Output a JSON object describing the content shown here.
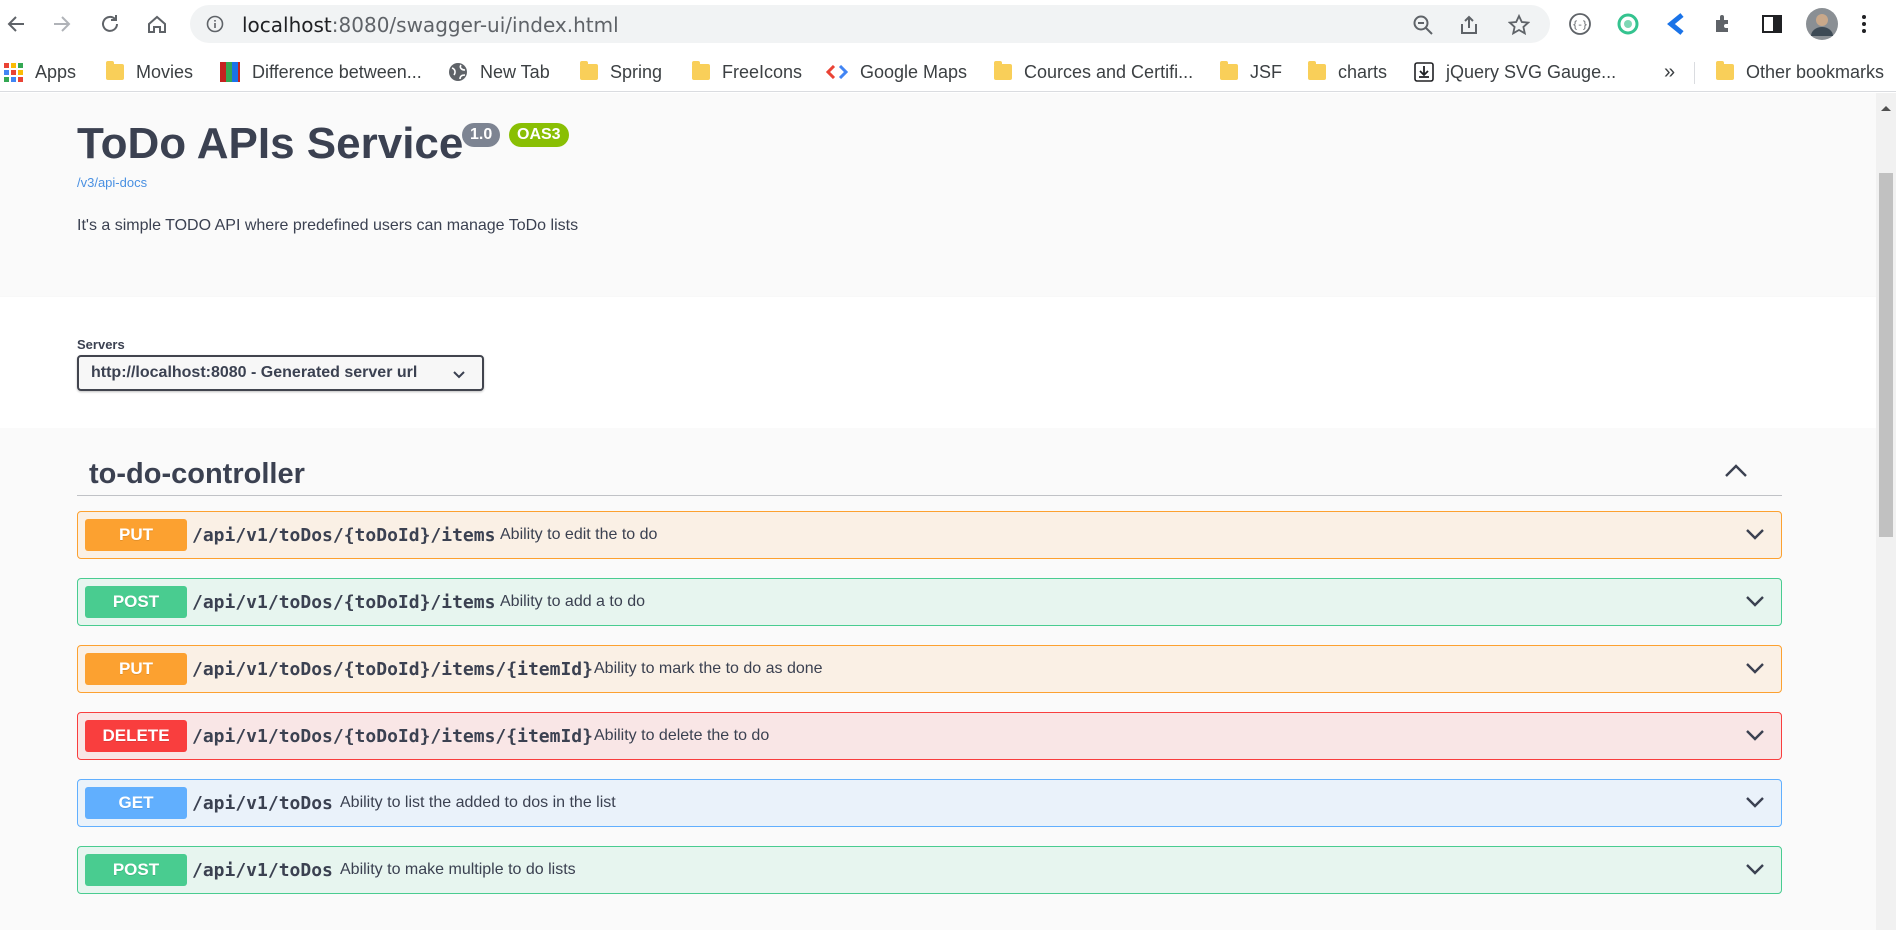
{
  "browser": {
    "url_host": "localhost",
    "url_rest": ":8080/swagger-ui/index.html",
    "bookmarks": [
      {
        "label": "Apps",
        "icon": "apps-grid-icon"
      },
      {
        "label": "Movies",
        "icon": "folder-icon"
      },
      {
        "label": "Difference between...",
        "icon": "site-icon"
      },
      {
        "label": "New Tab",
        "icon": "globe-icon"
      },
      {
        "label": "Spring",
        "icon": "folder-icon"
      },
      {
        "label": "FreeIcons",
        "icon": "folder-icon"
      },
      {
        "label": "Google Maps",
        "icon": "maps-icon"
      },
      {
        "label": "Cources and Certifi...",
        "icon": "folder-icon"
      },
      {
        "label": "JSF",
        "icon": "folder-icon"
      },
      {
        "label": "charts",
        "icon": "folder-icon"
      },
      {
        "label": "jQuery SVG Gauge...",
        "icon": "download-icon"
      }
    ],
    "overflow": "»",
    "other_bookmarks": "Other bookmarks"
  },
  "api": {
    "title": "ToDo APIs Service",
    "version": "1.0",
    "oas": "OAS3",
    "docs_link": "/v3/api-docs",
    "description": "It's a simple TODO API where predefined users can manage ToDo lists"
  },
  "servers": {
    "label": "Servers",
    "selected": "http://localhost:8080 - Generated server url"
  },
  "tag": {
    "name": "to-do-controller"
  },
  "operations": [
    {
      "method": "PUT",
      "path": "/api/v1/toDos/{toDoId}/items",
      "summary": "Ability to edit the to do"
    },
    {
      "method": "POST",
      "path": "/api/v1/toDos/{toDoId}/items",
      "summary": "Ability to add a to do"
    },
    {
      "method": "PUT",
      "path": "/api/v1/toDos/{toDoId}/items/{itemId}",
      "summary": "Ability to mark the to do as done"
    },
    {
      "method": "DELETE",
      "path": "/api/v1/toDos/{toDoId}/items/{itemId}",
      "summary": "Ability to delete the to do"
    },
    {
      "method": "GET",
      "path": "/api/v1/toDos",
      "summary": "Ability to list the added to dos in the list"
    },
    {
      "method": "POST",
      "path": "/api/v1/toDos",
      "summary": "Ability to make multiple to do lists"
    }
  ],
  "colors": {
    "put": "#fca130",
    "post": "#49cc90",
    "delete": "#f93e3e",
    "get": "#61affe"
  }
}
